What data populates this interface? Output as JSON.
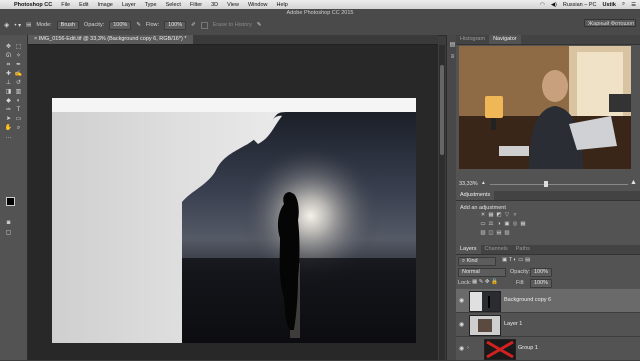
{
  "menubar": {
    "app": "Photoshop CC",
    "items": [
      "File",
      "Edit",
      "Image",
      "Layer",
      "Type",
      "Select",
      "Filter",
      "3D",
      "View",
      "Window",
      "Help"
    ],
    "language": "Russian – PC",
    "user": "Ustik"
  },
  "options": {
    "window_title": "Adobe Photoshop CC 2015",
    "mode_label": "Mode:",
    "mode_value": "Brush",
    "opacity_label": "Opacity:",
    "opacity_value": "100%",
    "flow_label": "Flow:",
    "flow_value": "100%",
    "erase_history": "Erase to History",
    "search_value": "Жарный Фотошоп"
  },
  "document": {
    "tab_label": "IMG_0156-Edit.tif @ 33,3% (Background copy 6, RGB/16*) *"
  },
  "navigator": {
    "tabs": [
      "Histogram",
      "Navigator"
    ],
    "active_tab": "Navigator",
    "zoom": "33,33%"
  },
  "adjustments": {
    "tab": "Adjustments",
    "add_label": "Add an adjustment",
    "row1_icons": [
      "☀",
      "▦",
      "◩",
      "▽",
      "▿"
    ],
    "row2_icons": [
      "▭",
      "⚖",
      "◑",
      "▣",
      "◎",
      "▦"
    ],
    "row3_icons": [
      "▧",
      "◫",
      "▤",
      "▨"
    ]
  },
  "layers_panel": {
    "tabs": [
      "Layers",
      "Channels",
      "Paths"
    ],
    "active_tab": "Layers",
    "filter_label": "Kind",
    "blend_mode": "Normal",
    "opacity_label": "Opacity:",
    "opacity_value": "100%",
    "lock_label": "Lock:",
    "fill_label": "Fill:",
    "fill_value": "100%",
    "layers": [
      {
        "name": "Background copy 6"
      },
      {
        "name": "Layer 1"
      },
      {
        "name": "Group 1"
      }
    ]
  },
  "colors": {
    "panel_bg": "#535353",
    "canvas_bg": "#282828",
    "selected_layer": "#6a6a6a"
  }
}
